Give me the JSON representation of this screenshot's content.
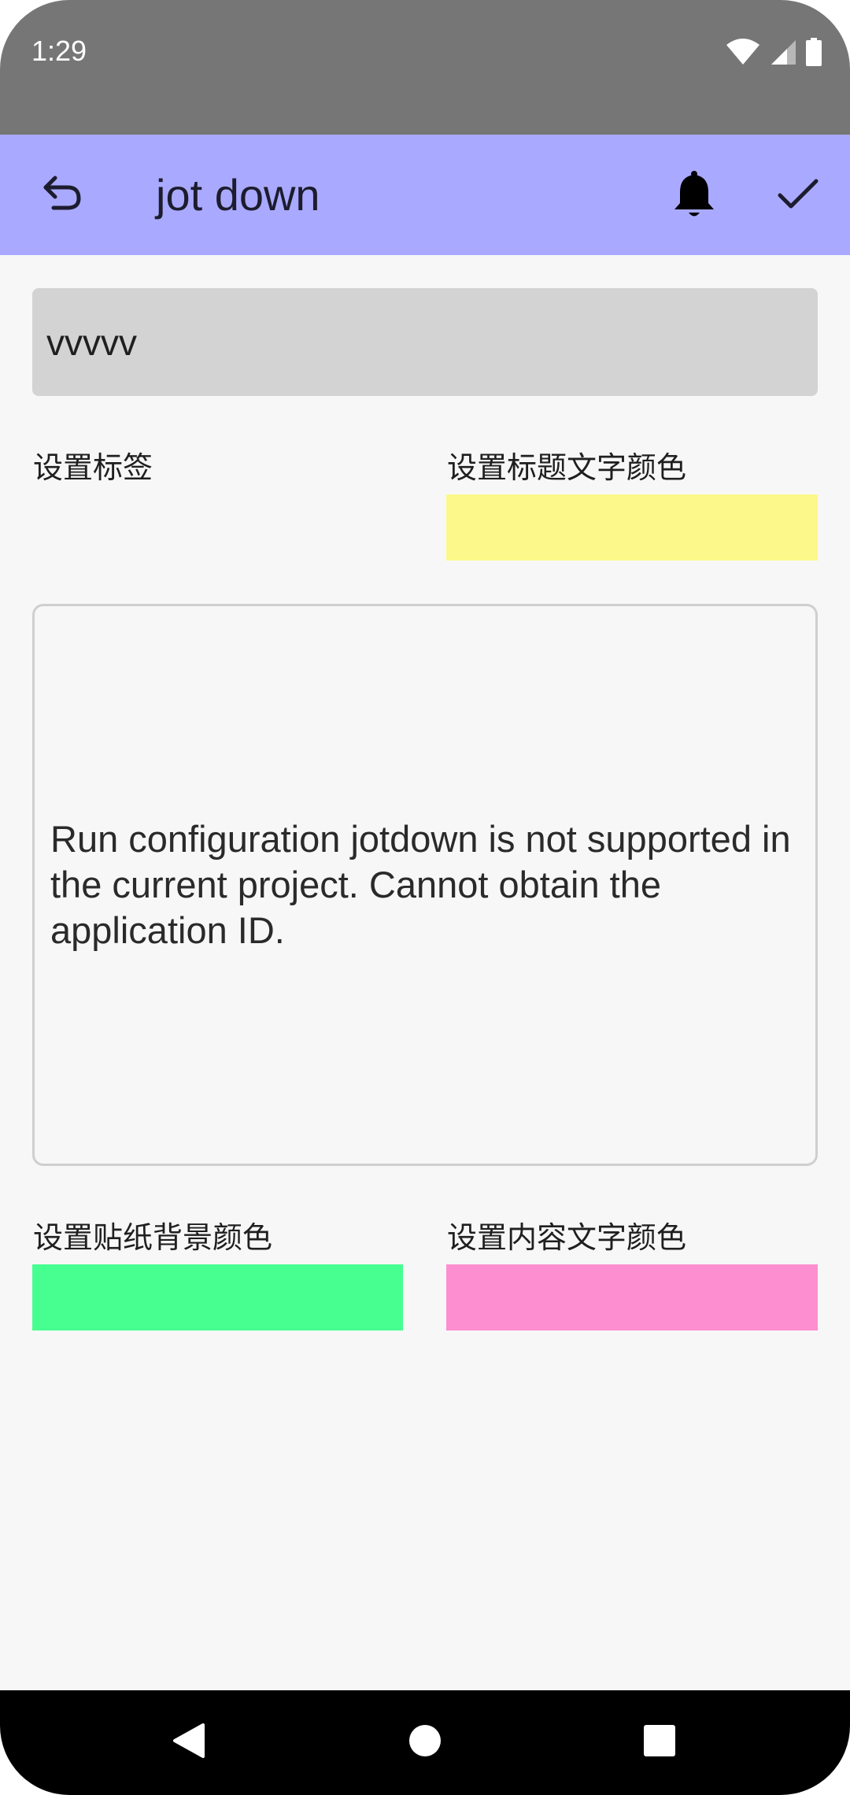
{
  "status_bar": {
    "time": "1:29",
    "icons": [
      "wifi-icon",
      "signal-icon",
      "battery-icon"
    ]
  },
  "app_bar": {
    "title": "jot down",
    "background": "#a9aaff",
    "icons": [
      "undo-back-icon",
      "bell-icon",
      "check-icon"
    ]
  },
  "note": {
    "title_value": "vvvvv",
    "content": "Run configuration jotdown is not supported in the current project. Cannot obtain the application ID."
  },
  "settings": {
    "tag_label": "设置标签",
    "title_color_label": "设置标题文字颜色",
    "title_color": "#fdf88a",
    "bg_color_label": "设置贴纸背景颜色",
    "bg_color": "#47fe91",
    "content_color_label": "设置内容文字颜色",
    "content_color": "#fd8ed0"
  },
  "nav_bar": {
    "icons": [
      "back-triangle-icon",
      "home-circle-icon",
      "recents-square-icon"
    ]
  }
}
